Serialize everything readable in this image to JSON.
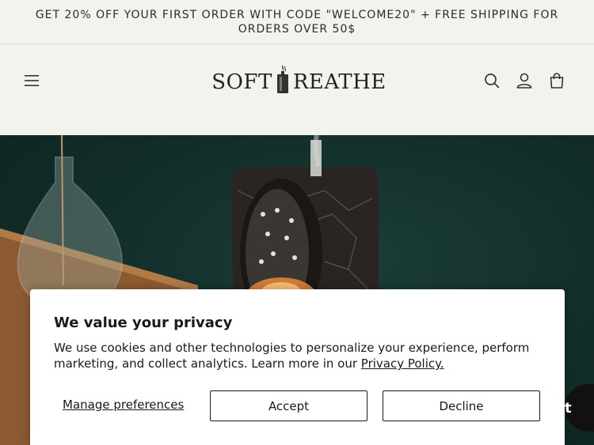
{
  "announcement": {
    "text": "GET 20% OFF YOUR FIRST ORDER WITH CODE \"WELCOME20\" + FREE SHIPPING FOR ORDERS OVER 50$"
  },
  "header": {
    "logo_left": "SOFT",
    "logo_right": "REATHE",
    "icons": {
      "menu": "hamburger-menu-icon",
      "search": "search-icon",
      "account": "account-icon",
      "cart": "cart-icon"
    }
  },
  "cookie_banner": {
    "title": "We value your privacy",
    "body": "We use cookies and other technologies to personalize your experience, perform marketing, and collect analytics. Learn more in our ",
    "policy_link": "Privacy Policy.",
    "manage_label": "Manage preferences",
    "accept_label": "Accept",
    "decline_label": "Decline"
  },
  "chat_widget": {
    "peek_text": "t"
  },
  "colors": {
    "background": "#f3f3ee",
    "hero_dark_green": "#13302c",
    "text": "#1e1e1e"
  }
}
